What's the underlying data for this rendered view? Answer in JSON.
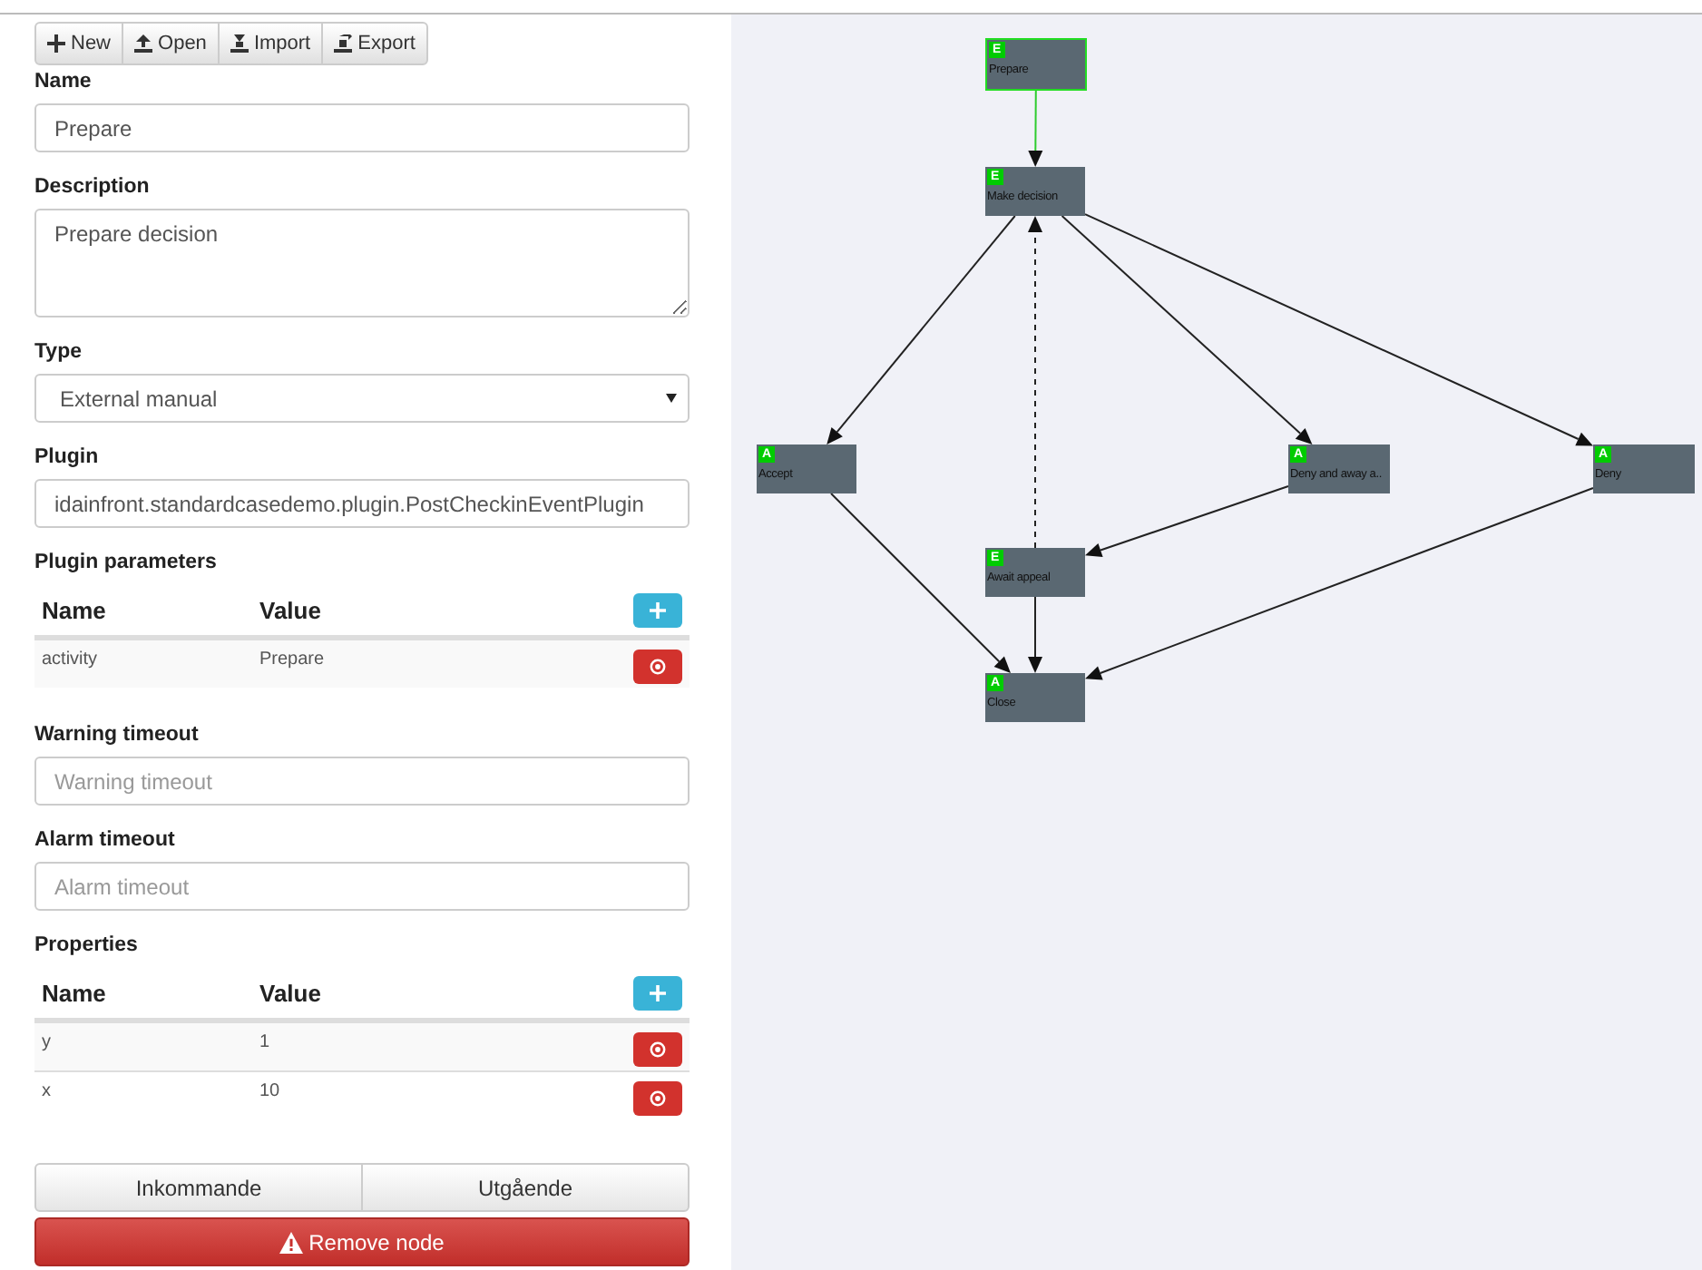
{
  "toolbar": [
    {
      "label": "New",
      "kind": "new"
    },
    {
      "label": "Open",
      "kind": "open"
    },
    {
      "label": "Import",
      "kind": "import"
    },
    {
      "label": "Export",
      "kind": "export"
    }
  ],
  "name": {
    "label": "Name",
    "value": "Prepare"
  },
  "description": {
    "label": "Description",
    "value": "Prepare decision"
  },
  "type": {
    "label": "Type",
    "value": "External manual"
  },
  "plugin": {
    "label": "Plugin",
    "value": "idainfront.standardcasedemo.plugin.PostCheckinEventPlugin"
  },
  "plugin_parameters": {
    "label": "Plugin parameters",
    "columns": [
      "Name",
      "Value"
    ],
    "rows": [
      {
        "name": "activity",
        "value": "Prepare"
      }
    ]
  },
  "warning_timeout": {
    "label": "Warning timeout",
    "placeholder": "Warning timeout"
  },
  "alarm_timeout": {
    "label": "Alarm timeout",
    "placeholder": "Alarm timeout"
  },
  "properties": {
    "label": "Properties",
    "columns": [
      "Name",
      "Value"
    ],
    "rows": [
      {
        "name": "y",
        "value": "1"
      },
      {
        "name": "x",
        "value": "10"
      }
    ]
  },
  "direction_tabs": [
    {
      "label": "Inkommande"
    },
    {
      "label": "Utgående"
    }
  ],
  "remove_button": "Remove node",
  "diagram": {
    "nodes": [
      {
        "badge": "E",
        "name": "Prepare",
        "selected": true
      },
      {
        "badge": "E",
        "name": "Make decision",
        "selected": false
      },
      {
        "badge": "A",
        "name": "Accept",
        "selected": false
      },
      {
        "badge": "A",
        "name": "Deny and away a..",
        "selected": false
      },
      {
        "badge": "A",
        "name": "Deny",
        "selected": false
      },
      {
        "badge": "E",
        "name": "Await appeal",
        "selected": false
      },
      {
        "badge": "A",
        "name": "Close",
        "selected": false
      }
    ],
    "edges": [
      {
        "dashed": false
      },
      {
        "dashed": false
      },
      {
        "dashed": false
      },
      {
        "dashed": false
      },
      {
        "dashed": true
      },
      {
        "dashed": false
      },
      {
        "dashed": false
      },
      {
        "dashed": false
      },
      {
        "dashed": false
      }
    ]
  }
}
